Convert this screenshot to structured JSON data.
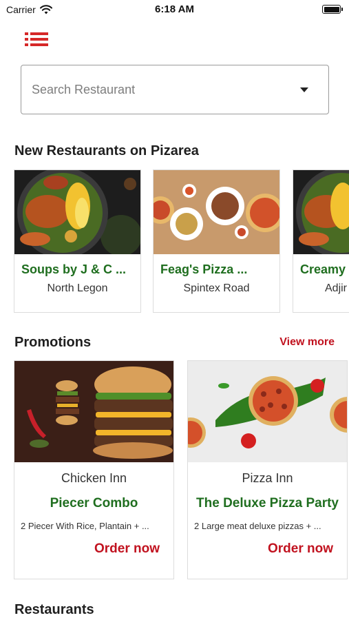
{
  "status_bar": {
    "carrier": "Carrier",
    "time": "6:18 AM"
  },
  "search": {
    "placeholder": "Search Restaurant"
  },
  "sections": {
    "new_restaurants": "New Restaurants on Pizarea",
    "promotions": "Promotions",
    "view_more": "View more",
    "restaurants": "Restaurants"
  },
  "new_restaurants": [
    {
      "name": "Soups by J & C ...",
      "location": "North Legon"
    },
    {
      "name": "Feag's Pizza ...",
      "location": "Spintex Road"
    },
    {
      "name": "Creamy",
      "location": "Adjir"
    }
  ],
  "promotions": [
    {
      "restaurant": "Chicken Inn",
      "title": "Piecer Combo",
      "description": "2 Piecer With Rice, Plantain + ...",
      "action": "Order now"
    },
    {
      "restaurant": "Pizza Inn",
      "title": "The Deluxe Pizza Party",
      "description": "2 Large meat deluxe pizzas + ...",
      "action": "Order now"
    }
  ],
  "colors": {
    "accent_red": "#c1121f",
    "title_green": "#1f6e1f"
  },
  "icons": [
    "wifi-icon",
    "battery-icon",
    "menu-icon",
    "dropdown-caret-icon"
  ]
}
